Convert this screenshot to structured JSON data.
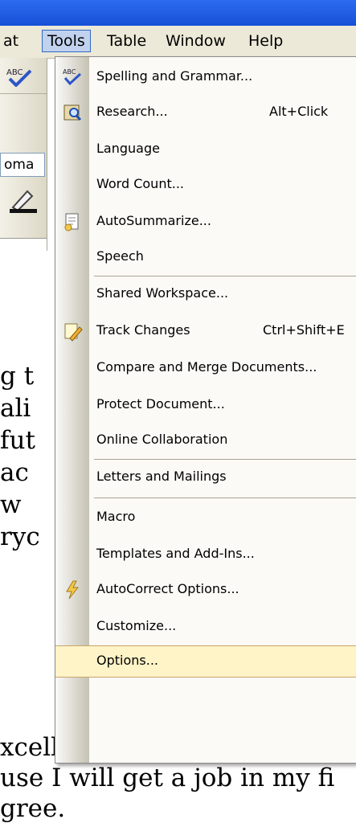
{
  "menubar": {
    "items": [
      {
        "label": "at"
      },
      {
        "label": "Tools"
      },
      {
        "label": "Table"
      },
      {
        "label": "Window"
      },
      {
        "label": "Help"
      }
    ]
  },
  "toolbar": {
    "font_name": "oma",
    "ruler_mark": "·"
  },
  "document": {
    "lines": [
      "g t",
      "ali",
      "fut",
      " ac",
      " w",
      "ryc",
      "xcellent grades.  Once I gr",
      "use I will get a job in my fi",
      "gree."
    ]
  },
  "tools_menu": {
    "items": [
      {
        "label": "Spelling and Grammar...",
        "shortcut": "",
        "icon": "spelling-abc-icon"
      },
      {
        "label": "Research...",
        "shortcut": "Alt+Click",
        "icon": "research-book-icon"
      },
      {
        "label": "Language",
        "shortcut": "",
        "icon": ""
      },
      {
        "label": "Word Count...",
        "shortcut": "",
        "icon": ""
      },
      {
        "label": "AutoSummarize...",
        "shortcut": "",
        "icon": "autosummarize-icon"
      },
      {
        "label": "Speech",
        "shortcut": "",
        "icon": ""
      },
      {
        "label": "Shared Workspace...",
        "shortcut": "",
        "icon": ""
      },
      {
        "label": "Track Changes",
        "shortcut": "Ctrl+Shift+E",
        "icon": "track-changes-icon"
      },
      {
        "label": "Compare and Merge Documents...",
        "shortcut": "",
        "icon": ""
      },
      {
        "label": "Protect Document...",
        "shortcut": "",
        "icon": ""
      },
      {
        "label": "Online Collaboration",
        "shortcut": "",
        "icon": ""
      },
      {
        "label": "Letters and Mailings",
        "shortcut": "",
        "icon": ""
      },
      {
        "label": "Macro",
        "shortcut": "",
        "icon": ""
      },
      {
        "label": "Templates and Add-Ins...",
        "shortcut": "",
        "icon": ""
      },
      {
        "label": "AutoCorrect Options...",
        "shortcut": "",
        "icon": "autocorrect-lightning-icon"
      },
      {
        "label": "Customize...",
        "shortcut": "",
        "icon": ""
      },
      {
        "label": "Options...",
        "shortcut": "",
        "icon": ""
      }
    ],
    "highlighted": "Options..."
  },
  "colors": {
    "title_bar": "#2c6cf0",
    "menu_active": "#c1d2ee",
    "highlight": "#fff3c8"
  }
}
